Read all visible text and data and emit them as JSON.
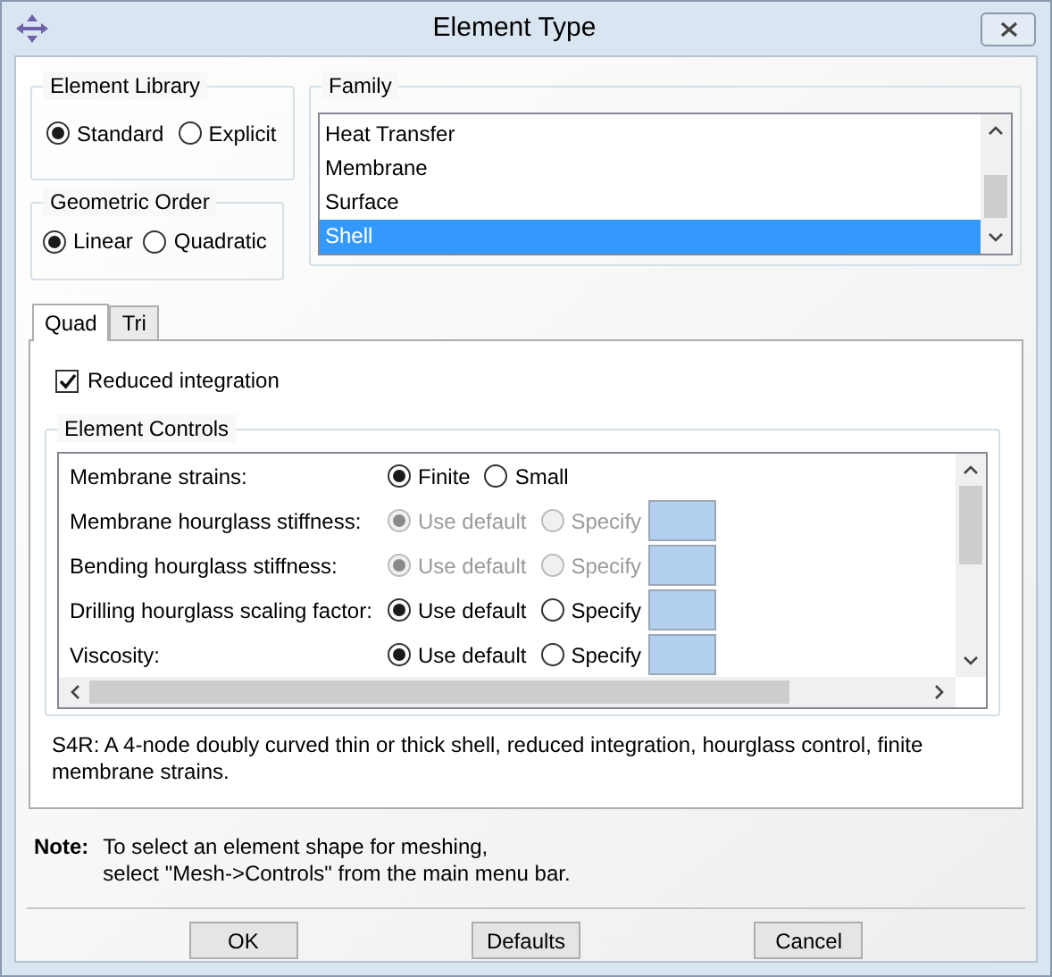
{
  "window": {
    "title": "Element Type"
  },
  "element_library": {
    "title": "Element Library",
    "options": [
      {
        "label": "Standard",
        "selected": true
      },
      {
        "label": "Explicit",
        "selected": false
      }
    ]
  },
  "geometric_order": {
    "title": "Geometric Order",
    "options": [
      {
        "label": "Linear",
        "selected": true
      },
      {
        "label": "Quadratic",
        "selected": false
      }
    ]
  },
  "family": {
    "title": "Family",
    "items": [
      {
        "label": "Heat Transfer",
        "selected": false
      },
      {
        "label": "Membrane",
        "selected": false
      },
      {
        "label": "Surface",
        "selected": false
      },
      {
        "label": "Shell",
        "selected": true
      }
    ]
  },
  "tabs": [
    {
      "label": "Quad",
      "selected": true
    },
    {
      "label": "Tri",
      "selected": false
    }
  ],
  "reduced_integration": {
    "label": "Reduced integration",
    "checked": true
  },
  "element_controls": {
    "title": "Element Controls",
    "rows": [
      {
        "label": "Membrane strains:",
        "kind": "choice",
        "disabled": false,
        "options": [
          {
            "label": "Finite",
            "selected": true
          },
          {
            "label": "Small",
            "selected": false
          }
        ]
      },
      {
        "label": "Membrane hourglass stiffness:",
        "kind": "choice_field",
        "disabled": true,
        "options": [
          {
            "label": "Use default",
            "selected": true
          },
          {
            "label": "Specify",
            "selected": false
          }
        ]
      },
      {
        "label": "Bending hourglass stiffness:",
        "kind": "choice_field",
        "disabled": true,
        "options": [
          {
            "label": "Use default",
            "selected": true
          },
          {
            "label": "Specify",
            "selected": false
          }
        ]
      },
      {
        "label": "Drilling hourglass scaling factor:",
        "kind": "choice_field",
        "disabled": false,
        "options": [
          {
            "label": "Use default",
            "selected": true
          },
          {
            "label": "Specify",
            "selected": false
          }
        ]
      },
      {
        "label": "Viscosity:",
        "kind": "choice_field",
        "disabled": false,
        "options": [
          {
            "label": "Use default",
            "selected": true
          },
          {
            "label": "Specify",
            "selected": false
          }
        ]
      }
    ]
  },
  "description": "S4R:  A 4-node doubly curved thin or thick shell, reduced integration, hourglass control, finite membrane strains.",
  "note": {
    "label": "Note:",
    "lines": [
      "To select an element shape for meshing,",
      "select \"Mesh->Controls\" from the main menu bar."
    ]
  },
  "buttons": [
    "OK",
    "Defaults",
    "Cancel"
  ]
}
